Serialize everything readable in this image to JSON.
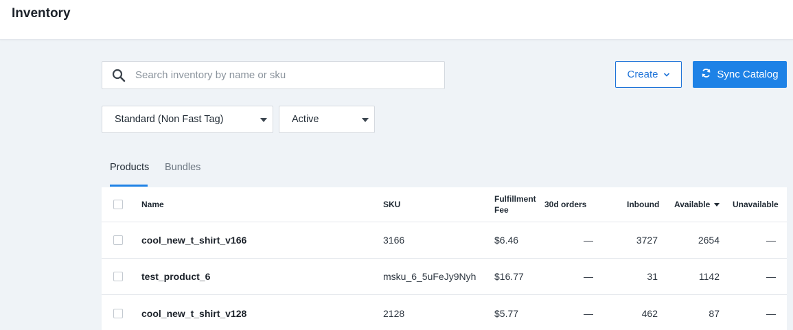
{
  "header": {
    "title": "Inventory"
  },
  "search": {
    "placeholder": "Search inventory by name or sku",
    "value": ""
  },
  "actions": {
    "create_label": "Create",
    "sync_label": "Sync Catalog"
  },
  "filters": {
    "type_value": "Standard (Non Fast Tag)",
    "status_value": "Active"
  },
  "tabs": [
    {
      "label": "Products",
      "active": true
    },
    {
      "label": "Bundles",
      "active": false
    }
  ],
  "table": {
    "columns": {
      "name": "Name",
      "sku": "SKU",
      "fee": "Fulfillment Fee",
      "fee_line1": "Fulfillment",
      "fee_line2": "Fee",
      "orders": "30d orders",
      "inbound": "Inbound",
      "available": "Available",
      "unavailable": "Unavailable"
    },
    "rows": [
      {
        "name": "cool_new_t_shirt_v166",
        "sku": "3166",
        "fee": "$6.46",
        "orders": "—",
        "inbound": "3727",
        "available": "2654",
        "unavailable": "—"
      },
      {
        "name": "test_product_6",
        "sku": "msku_6_5uFeJy9Nyh",
        "fee": "$16.77",
        "orders": "—",
        "inbound": "31",
        "available": "1142",
        "unavailable": "—"
      },
      {
        "name": "cool_new_t_shirt_v128",
        "sku": "2128",
        "fee": "$5.77",
        "orders": "—",
        "inbound": "462",
        "available": "87",
        "unavailable": "—"
      }
    ]
  },
  "colors": {
    "accent": "#1e82e6",
    "background": "#eff3f7"
  },
  "icons": {
    "search": "search-icon",
    "create_caret": "chevron-down-icon",
    "sync": "sync-icon",
    "sort": "sort-desc-icon"
  }
}
